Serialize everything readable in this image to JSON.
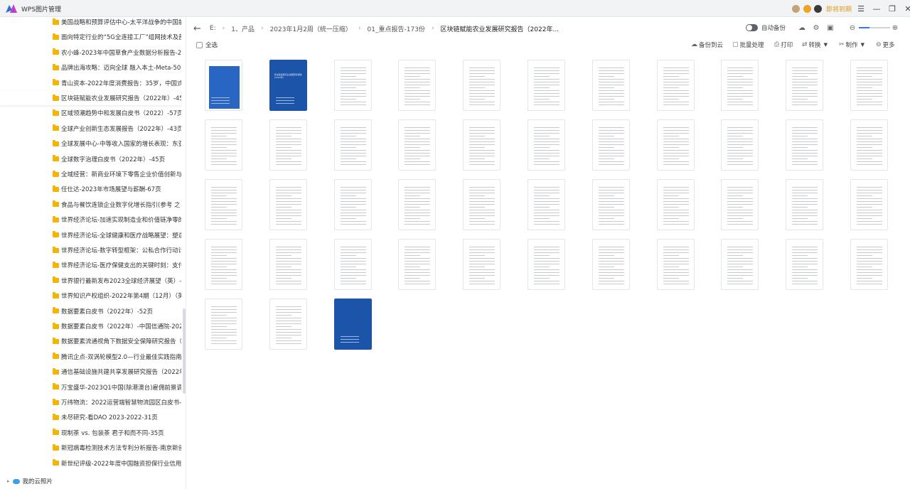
{
  "app": {
    "title": "WPS图片管理",
    "login_label": "即将到期"
  },
  "window_controls": [
    "menu-icon",
    "minimize-icon",
    "restore-icon",
    "close-icon"
  ],
  "sidebar": {
    "items": [
      "美国战略和预算评估中心-太平洋战争的中国前线",
      "面向特定行业的“5G全连接工厂”组网技术及部署",
      "农小蜂-2023年中国草食产业数据分析报告-25页",
      "品牌出海攻略：迈向全球 融入本土-Meta-50页",
      "青山资本-2022年度消费报告：35岁，中国式中年",
      "区块链赋能农业发展研究报告（2022年）-45页",
      "区域领潮趋势中和发展白皮书（2022）-57页",
      "全球产业创新生态发展报告（2022年）-43页",
      "全球发展中心-中等收入国家的增长表现：东亚和",
      "全球数字治理白皮书（2022年）-45页",
      "全域经营：新商业环境下零售企业价值创新与增",
      "任仕达-2023年市场展望与薪酬-67页",
      "食品与餐饮连锁企业数字化增长指引(参考 之 数",
      "世界经济论坛-加速实现制造业和价值链净零的",
      "世界经济论坛-全球健康和医疗战略展望：塑造韧",
      "世界经济论坛-数字转型框架：公私合作行动计",
      "世界经济论坛-医疗保健支出的关键时刻：支付模",
      "世界银行最新发布2023全球经济展望（英）-20",
      "世界知识产权组织-2022年第4期（12月）（英文",
      "数据要素白皮书（2022年）-52页",
      "数据要素白皮书（2022年）-中国信通院-2023.",
      "数据要素流通视角下数据安全保障研究报告（20",
      "腾讯企点-双涡轮模型2.0—行业最佳实践指南-5",
      "通信基础设施共建共享发展研究报告（2022年）",
      "万宝盛华-2023Q1中国(除港澳台)雇佣前景调查",
      "万纬物流：2022运营端智慧物流园区白皮书-28",
      "未尽研究-看DAO 2023-2022-31页",
      "现制茶 vs. 包装茶 君子和而不同-35页",
      "新冠病毒检测技术方法专利分析报告-南京新创",
      "新世纪评级-2022年度中国融资担保行业信用回"
    ],
    "active_index": 5,
    "cloud_label": "我的云照片"
  },
  "breadcrumb": {
    "parts": [
      "E:",
      "1、产品",
      "2023年1月2周（统一压缩）",
      "01_重点报告-173份"
    ],
    "current": "区块链赋能农业发展研究报告（2022年..."
  },
  "auto_backup": {
    "label": "自动备份",
    "enabled": false
  },
  "zoom_level": 0.35,
  "toolbar": {
    "select_all": "全选",
    "actions": [
      "备份到云",
      "批量处理",
      "打印",
      "转换",
      "制作",
      "更多"
    ]
  },
  "thumbnails": {
    "count": 47,
    "blue_cover_indices": [
      0,
      1,
      46
    ],
    "cover_title": "区块链赋能农业发展研究报告 (2022年)"
  }
}
